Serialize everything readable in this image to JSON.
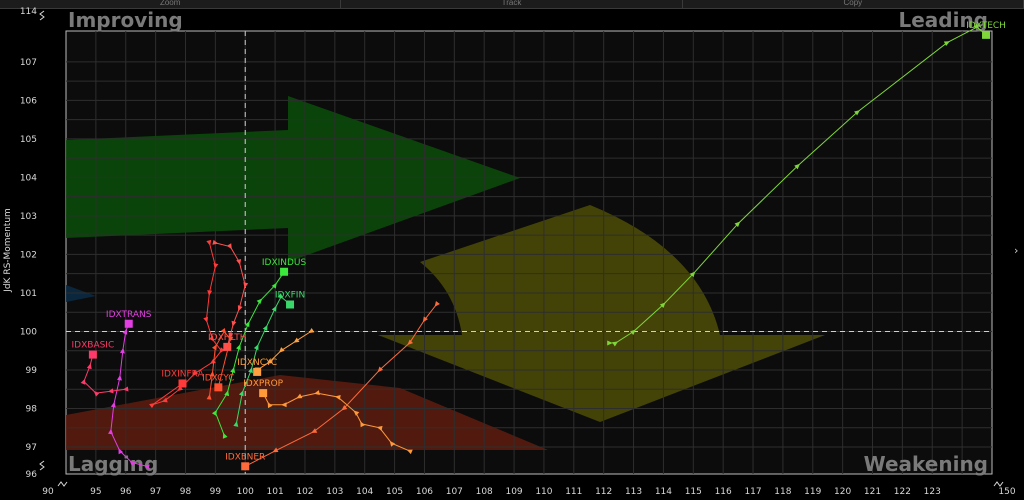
{
  "toolbar": {
    "tabs": [
      "Zoom",
      "Track",
      "Copy"
    ]
  },
  "chart_data": {
    "type": "scatter",
    "title": "",
    "xlabel": "",
    "ylabel": "JdK RS-Momentum",
    "xlim": [
      94,
      125
    ],
    "ylim": [
      96.3,
      107.8
    ],
    "x_ticks": [
      90,
      95,
      96,
      97,
      98,
      99,
      100,
      101,
      102,
      103,
      104,
      105,
      106,
      107,
      108,
      109,
      110,
      111,
      112,
      113,
      114,
      115,
      116,
      117,
      118,
      119,
      120,
      121,
      122,
      123,
      150
    ],
    "y_ticks": [
      114,
      107,
      106,
      105,
      104,
      103,
      102,
      101,
      100,
      99,
      98,
      97,
      96
    ],
    "reference_lines": {
      "x": 100,
      "y": 100
    },
    "quadrants": {
      "top_left": "Improving",
      "top_right": "Leading",
      "bottom_left": "Lagging",
      "bottom_right": "Weakening"
    },
    "grid": true,
    "series": [
      {
        "name": "IDXTECH",
        "color": "#7fd63a",
        "points": [
          [
            112.2,
            99.7
          ],
          [
            112.4,
            99.7
          ],
          [
            113.0,
            100.0
          ],
          [
            114.0,
            100.7
          ],
          [
            115.0,
            101.5
          ],
          [
            116.5,
            102.8
          ],
          [
            118.5,
            104.3
          ],
          [
            120.5,
            105.7
          ],
          [
            123.5,
            107.5
          ],
          [
            124.5,
            107.9
          ],
          [
            124.8,
            107.7
          ]
        ]
      },
      {
        "name": "IDXINDUS",
        "color": "#3ce83c",
        "points": [
          [
            99.3,
            97.3
          ],
          [
            99.0,
            97.9
          ],
          [
            99.4,
            98.4
          ],
          [
            99.6,
            99.0
          ],
          [
            99.8,
            99.6
          ],
          [
            100.1,
            100.2
          ],
          [
            100.5,
            100.8
          ],
          [
            101.0,
            101.2
          ],
          [
            101.3,
            101.55
          ]
        ]
      },
      {
        "name": "IDXFIN",
        "color": "#38d86a",
        "points": [
          [
            99.7,
            97.6
          ],
          [
            99.9,
            98.4
          ],
          [
            100.2,
            99.0
          ],
          [
            100.4,
            99.6
          ],
          [
            100.7,
            100.1
          ],
          [
            101.0,
            100.6
          ],
          [
            101.2,
            100.9
          ],
          [
            101.5,
            100.7
          ]
        ]
      },
      {
        "name": "IDXTRANS",
        "color": "#e23ee2",
        "points": [
          [
            96.7,
            96.5
          ],
          [
            96.2,
            96.6
          ],
          [
            95.8,
            96.9
          ],
          [
            95.5,
            97.4
          ],
          [
            95.6,
            98.1
          ],
          [
            95.8,
            98.8
          ],
          [
            95.9,
            99.5
          ],
          [
            96.0,
            100.0
          ],
          [
            96.1,
            100.2
          ]
        ]
      },
      {
        "name": "IDXBASIC",
        "color": "#ff3a6a",
        "points": [
          [
            96.0,
            98.5
          ],
          [
            95.5,
            98.45
          ],
          [
            95.0,
            98.4
          ],
          [
            94.6,
            98.7
          ],
          [
            94.8,
            99.1
          ],
          [
            94.9,
            99.4
          ]
        ]
      },
      {
        "name": "IDXINFRA",
        "color": "#ff3a3a",
        "points": [
          [
            98.8,
            102.3
          ],
          [
            99.0,
            101.7
          ],
          [
            98.8,
            101.0
          ],
          [
            98.7,
            100.3
          ],
          [
            98.9,
            99.8
          ],
          [
            99.2,
            99.5
          ],
          [
            98.9,
            99.2
          ],
          [
            98.3,
            98.9
          ],
          [
            97.8,
            98.5
          ],
          [
            97.3,
            98.2
          ],
          [
            96.9,
            98.1
          ],
          [
            97.9,
            98.65
          ]
        ]
      },
      {
        "name": "IDXHLTH",
        "color": "#ff5050",
        "points": [
          [
            99.0,
            102.3
          ],
          [
            99.5,
            102.2
          ],
          [
            99.8,
            101.8
          ],
          [
            100.0,
            101.2
          ],
          [
            99.8,
            100.6
          ],
          [
            99.6,
            100.2
          ],
          [
            99.5,
            99.9
          ],
          [
            99.4,
            99.6
          ]
        ]
      },
      {
        "name": "IDXCYC",
        "color": "#ff5030",
        "points": [
          [
            98.8,
            98.3
          ],
          [
            98.9,
            98.9
          ],
          [
            99.0,
            99.6
          ],
          [
            99.3,
            100.0
          ],
          [
            99.5,
            99.8
          ],
          [
            99.1,
            98.55
          ]
        ]
      },
      {
        "name": "IDXNCYC",
        "color": "#ffa040",
        "points": [
          [
            102.2,
            100.0
          ],
          [
            101.7,
            99.75
          ],
          [
            101.2,
            99.5
          ],
          [
            100.8,
            99.2
          ],
          [
            100.4,
            99.0
          ],
          [
            100.4,
            98.95
          ]
        ]
      },
      {
        "name": "IDXPROP",
        "color": "#ff9a3a",
        "points": [
          [
            105.5,
            96.9
          ],
          [
            104.9,
            97.1
          ],
          [
            104.5,
            97.5
          ],
          [
            103.9,
            97.6
          ],
          [
            103.7,
            97.9
          ],
          [
            103.1,
            98.3
          ],
          [
            102.4,
            98.4
          ],
          [
            101.8,
            98.3
          ],
          [
            101.3,
            98.1
          ],
          [
            100.8,
            98.1
          ],
          [
            100.6,
            98.4
          ]
        ]
      },
      {
        "name": "IDXENER",
        "color": "#ff6a3a",
        "points": [
          [
            106.4,
            100.7
          ],
          [
            106.0,
            100.3
          ],
          [
            105.5,
            99.7
          ],
          [
            104.5,
            99.0
          ],
          [
            103.3,
            98.0
          ],
          [
            102.3,
            97.4
          ],
          [
            101.0,
            96.9
          ],
          [
            100.0,
            96.5
          ]
        ]
      }
    ]
  },
  "colors": {
    "background": "#000000",
    "plot_area": "#0c0c0c",
    "grid": "#2e2e2e",
    "improving_arrow": "#0b4a0b",
    "weakening_arrow": "#4a4a08",
    "lagging_arrow": "#5a1c10",
    "quadrant_label": "#7a7a7a"
  }
}
